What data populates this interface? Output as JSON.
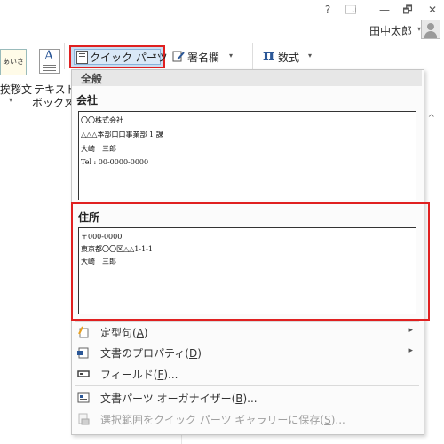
{
  "window": {
    "help_glyph": "?",
    "restore_glyph": "🗔",
    "minimize_glyph": "—",
    "maximize_glyph": "🗗",
    "close_glyph": "✕",
    "user_name": "田中太郎",
    "user_caret": "▾"
  },
  "ribbon": {
    "greeting_icon_text": "あいさつ",
    "greeting_label": "挨拶文",
    "textbox_label_line1": "テキスト",
    "textbox_label_line2": "ボックス",
    "textbox_caret": "▾",
    "quick_parts_label": "クイック パーツ",
    "quick_parts_caret": "▾",
    "signature_label": "署名欄",
    "signature_caret": "▾",
    "equation_label": "数式",
    "equation_caret": "▾",
    "collapse_glyph": "^"
  },
  "gallery": {
    "category": "全般",
    "entries": [
      {
        "title": "会社",
        "lines": [
          "〇〇株式会社",
          "△△△本部口口事業部 1 課",
          "大崎　三郎",
          "Tel : 00-0000-0000"
        ]
      },
      {
        "title": "住所",
        "lines": [
          "〒000-0000",
          "東京都〇〇区△△1-1-1",
          "大崎　三郎"
        ]
      }
    ]
  },
  "menu": {
    "autotext": {
      "label": "定型句(",
      "key": "A",
      "suffix": ")",
      "arrow": "▸"
    },
    "doc_property": {
      "label": "文書のプロパティ(",
      "key": "D",
      "suffix": ")",
      "arrow": "▸"
    },
    "field": {
      "label": "フィールド(",
      "key": "F",
      "suffix": ")..."
    },
    "organizer": {
      "label": "文書パーツ オーガナイザー(",
      "key": "B",
      "suffix": ")..."
    },
    "save_selection": {
      "label": "選択範囲をクイック パーツ ギャラリーに保存(",
      "key": "S",
      "suffix": ")..."
    }
  },
  "colors": {
    "highlight": "#e02020",
    "ribbon_selected": "#c8ddf1",
    "accent": "#2b5797"
  }
}
